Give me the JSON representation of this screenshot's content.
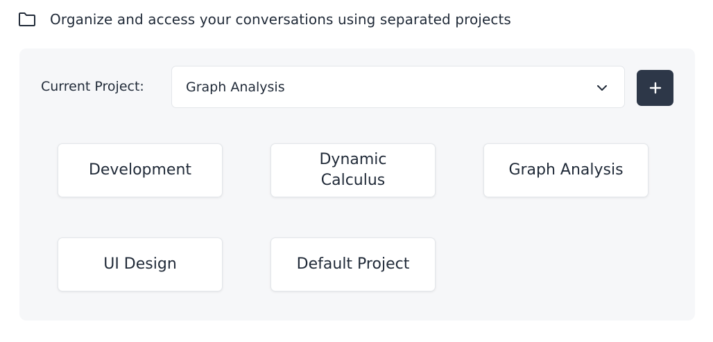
{
  "header": {
    "icon": "folder-icon",
    "text": "Organize and access your conversations using separated projects"
  },
  "project_selector": {
    "label": "Current Project:",
    "selected": "Graph Analysis",
    "dropdown_icon": "chevron-down-icon",
    "add_button_icon": "plus-icon",
    "add_button_color": "#2d3748"
  },
  "projects": [
    {
      "name": "Development"
    },
    {
      "name": "Dynamic Calculus"
    },
    {
      "name": "Graph Analysis"
    },
    {
      "name": "UI Design"
    },
    {
      "name": "Default Project"
    }
  ]
}
